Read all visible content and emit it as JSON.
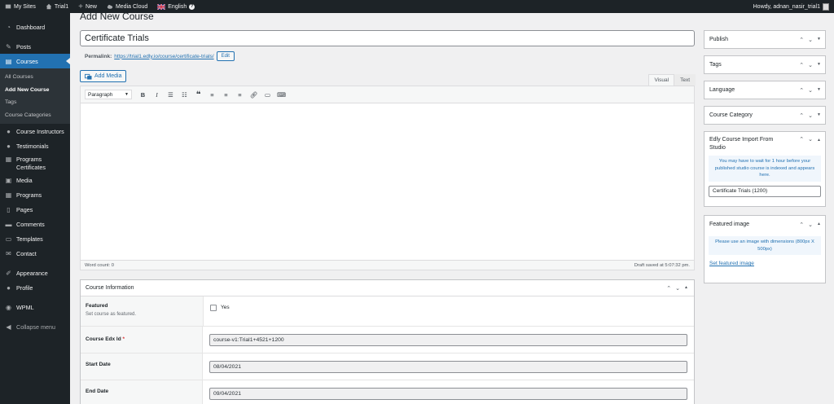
{
  "adminbar": {
    "my_sites": "My Sites",
    "site_name": "Trial1",
    "new": "New",
    "media_cloud": "Media Cloud",
    "language": "English",
    "greeting": "Howdy, adnan_nasir_trial1"
  },
  "sidebar": {
    "items": [
      {
        "label": "Dashboard",
        "icon": "dashboard-icon"
      },
      {
        "label": "Posts",
        "icon": "pin-icon"
      },
      {
        "label": "Courses",
        "icon": "book-icon"
      }
    ],
    "courses_submenu": [
      "All Courses",
      "Add New Course",
      "Tags",
      "Course Categories"
    ],
    "items2": [
      {
        "label": "Course Instructors",
        "icon": "user-icon"
      },
      {
        "label": "Testimonials",
        "icon": "users-icon"
      },
      {
        "label": "Programs Certificates",
        "icon": "certificate-icon"
      },
      {
        "label": "Media",
        "icon": "media-icon"
      },
      {
        "label": "Programs",
        "icon": "programs-icon"
      },
      {
        "label": "Pages",
        "icon": "page-icon"
      },
      {
        "label": "Comments",
        "icon": "comment-icon"
      },
      {
        "label": "Templates",
        "icon": "folder-icon"
      },
      {
        "label": "Contact",
        "icon": "mail-icon"
      },
      {
        "label": "Appearance",
        "icon": "brush-icon"
      },
      {
        "label": "Profile",
        "icon": "profile-icon"
      },
      {
        "label": "WPML",
        "icon": "wpml-icon"
      },
      {
        "label": "Collapse menu",
        "icon": "collapse-icon"
      }
    ]
  },
  "main": {
    "page_title": "Add New Course",
    "course_title": "Certificate Trials",
    "permalink_label": "Permalink:",
    "permalink_url": "https://trial1.edly.io/course/certificate-trials/",
    "edit_label": "Edit",
    "add_media_label": "Add Media",
    "tab_visual": "Visual",
    "tab_text": "Text",
    "format_select": "Paragraph",
    "word_count": "Word count: 0",
    "draft_saved": "Draft saved at 5:07:32 pm."
  },
  "course_info": {
    "title": "Course Information",
    "featured_label": "Featured",
    "featured_desc": "Set course as featured.",
    "featured_option": "Yes",
    "edx_id_label": "Course Edx Id",
    "edx_id_required": "*",
    "edx_id_value": "course-v1:Trial1+4521+1200",
    "start_date_label": "Start Date",
    "start_date_value": "08/04/2021",
    "end_date_label": "End Date",
    "end_date_value": "09/04/2021"
  },
  "side": {
    "publish": "Publish",
    "tags": "Tags",
    "language": "Language",
    "course_category": "Course Category",
    "import_title": "Edly Course Import From Studio",
    "import_notice": "You may have to wait for 1 hour before your published studio course is indexed and appears here.",
    "import_value": "Certificate Trials (1200)",
    "featured_image": "Featured image",
    "image_notice": "Please use an image with dimensions (800px X 500px)",
    "set_featured": "Set featured image"
  }
}
